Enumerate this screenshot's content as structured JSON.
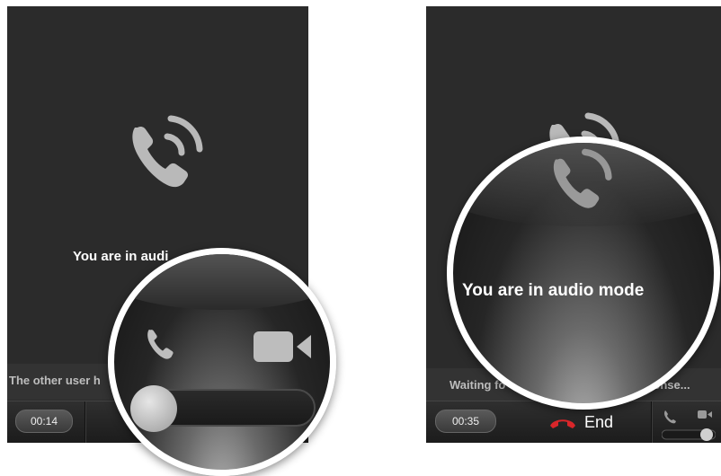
{
  "left_panel": {
    "mode_text": "You are in audi",
    "status_text": "The other user h",
    "timer": "00:14",
    "zoom": {
      "audio_icon": "phone-icon",
      "video_icon": "video-camera-icon",
      "toggle_position": 0.0
    }
  },
  "right_panel": {
    "status_text_start": "Waiting fo",
    "status_text_end": "esponse...",
    "timer": "00:35",
    "end_label": "End",
    "zoom": {
      "mode_text": "You are in audio mode"
    }
  },
  "colors": {
    "background": "#2b2b2b",
    "end_icon": "#d9262a",
    "lens_border": "#ffffff"
  }
}
